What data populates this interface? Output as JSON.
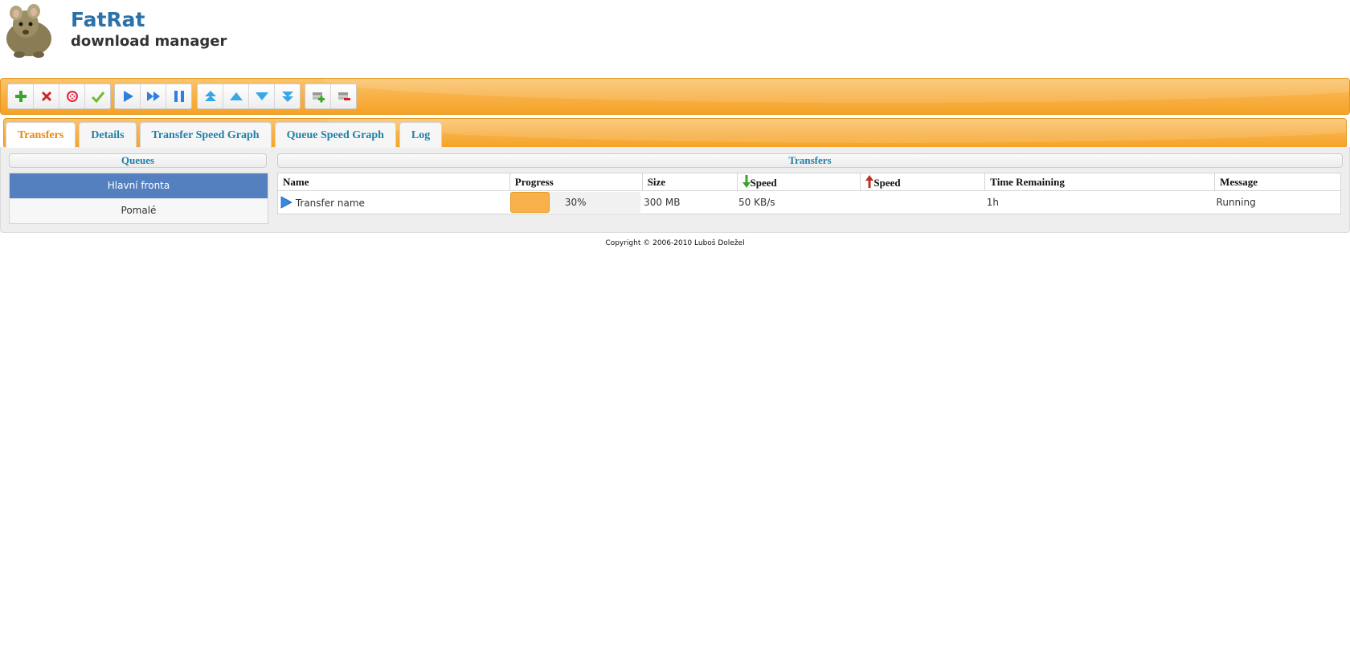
{
  "header": {
    "title": "FatRat",
    "subtitle": "download manager",
    "logo": "rat-logo"
  },
  "toolbar": {
    "groups": [
      [
        {
          "icon": "add-icon"
        },
        {
          "icon": "delete-icon"
        },
        {
          "icon": "delete-with-data-icon"
        },
        {
          "icon": "remove-completed-icon"
        }
      ],
      [
        {
          "icon": "resume-icon"
        },
        {
          "icon": "force-resume-icon"
        },
        {
          "icon": "pause-icon"
        }
      ],
      [
        {
          "icon": "move-top-icon"
        },
        {
          "icon": "move-up-icon"
        },
        {
          "icon": "move-down-icon"
        },
        {
          "icon": "move-bottom-icon"
        }
      ],
      [
        {
          "icon": "add-queue-icon"
        },
        {
          "icon": "remove-queue-icon"
        }
      ]
    ]
  },
  "tabs": [
    {
      "label": "Transfers",
      "active": true
    },
    {
      "label": "Details",
      "active": false
    },
    {
      "label": "Transfer Speed Graph",
      "active": false
    },
    {
      "label": "Queue Speed Graph",
      "active": false
    },
    {
      "label": "Log",
      "active": false
    }
  ],
  "queues": {
    "heading": "Queues",
    "items": [
      {
        "label": "Hlavní fronta",
        "selected": true
      },
      {
        "label": "Pomalé",
        "selected": false
      }
    ]
  },
  "transfers": {
    "heading": "Transfers",
    "columns": {
      "name": "Name",
      "progress": "Progress",
      "size": "Size",
      "down_speed": "Speed",
      "up_speed": "Speed",
      "time_remaining": "Time Remaining",
      "message": "Message"
    },
    "rows": [
      {
        "name": "Transfer name",
        "progress": 30,
        "progress_label": "30%",
        "size": "300 MB",
        "down_speed": "50 KB/s",
        "up_speed": "",
        "time_remaining": "1h",
        "message": "Running",
        "state_icon": "play-icon"
      }
    ]
  },
  "footer": {
    "copyright": "Copyright © 2006-2010 Luboš Doležel"
  },
  "colors": {
    "accent_orange": "#f5a326",
    "title_blue": "#2b72a8",
    "tab_blue": "#1f80a8",
    "selected_blue": "#5580c0"
  }
}
